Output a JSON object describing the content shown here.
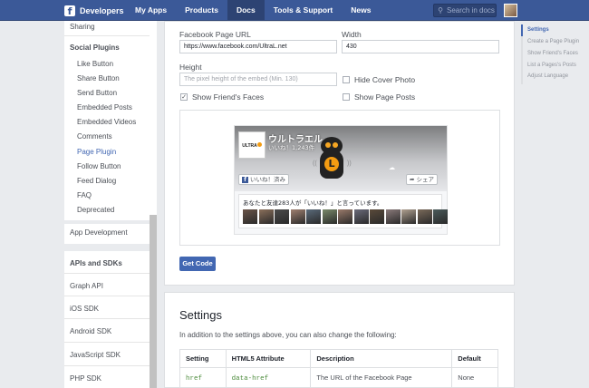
{
  "topbar": {
    "brand": "Developers",
    "nav": [
      "My Apps",
      "Products",
      "Docs",
      "Tools & Support",
      "News"
    ],
    "active_nav": 2,
    "search_placeholder": "Search in docs",
    "colors": {
      "bar": "#3b5998",
      "active": "#2d4373"
    }
  },
  "sidebar": {
    "sharing": "Sharing",
    "social_heading": "Social Plugins",
    "social_items": [
      "Like Button",
      "Share Button",
      "Send Button",
      "Embedded Posts",
      "Embedded Videos",
      "Comments",
      "Page Plugin",
      "Follow Button",
      "Feed Dialog",
      "FAQ",
      "Deprecated"
    ],
    "active_item": "Page Plugin",
    "app_dev": "App Development",
    "apis_heading": "APIs and SDKs",
    "apis_items": [
      "Graph API",
      "iOS SDK",
      "Android SDK",
      "JavaScript SDK",
      "PHP SDK"
    ]
  },
  "form": {
    "url_label": "Facebook Page URL",
    "url_value": "https://www.facebook.com/UltraL.net",
    "width_label": "Width",
    "width_value": "430",
    "height_label": "Height",
    "height_placeholder": "The pixel height of the embed (Min. 130)",
    "hide_cover_label": "Hide Cover Photo",
    "hide_cover_checked": false,
    "show_faces_label": "Show Friend's Faces",
    "show_faces_checked": true,
    "show_posts_label": "Show Page Posts",
    "show_posts_checked": false,
    "get_code": "Get Code"
  },
  "preview": {
    "page_name": "ウルトラエル",
    "likes": "いいね！1,243件",
    "logo_text": "ULTRA",
    "like_btn": "いいね！済み",
    "share_btn": "シェア",
    "friends_text": "あなたと友達283人が「いいね！」と言っています。",
    "faces": [
      "#6a5448",
      "#8a6f5a",
      "#4a4a4a",
      "#a08070",
      "#5a6a7a",
      "#7a8a6a",
      "#9a7a6a",
      "#6a6a7a",
      "#5a4a3a",
      "#8a7a7a",
      "#b0a090",
      "#7a6a5a",
      "#4a5a5a"
    ]
  },
  "settings": {
    "heading": "Settings",
    "intro": "In addition to the settings above, you can also change the following:",
    "columns": [
      "Setting",
      "HTML5 Attribute",
      "Description",
      "Default"
    ],
    "rows": [
      {
        "setting": "href",
        "attr": "data-href",
        "desc": "The URL of the Facebook Page",
        "default": "None"
      }
    ]
  },
  "toc": {
    "items": [
      "Settings",
      "Create a Page Plugin",
      "Show Friend's Faces",
      "List a Pages's Posts",
      "Adjust Language"
    ],
    "active": 0
  }
}
